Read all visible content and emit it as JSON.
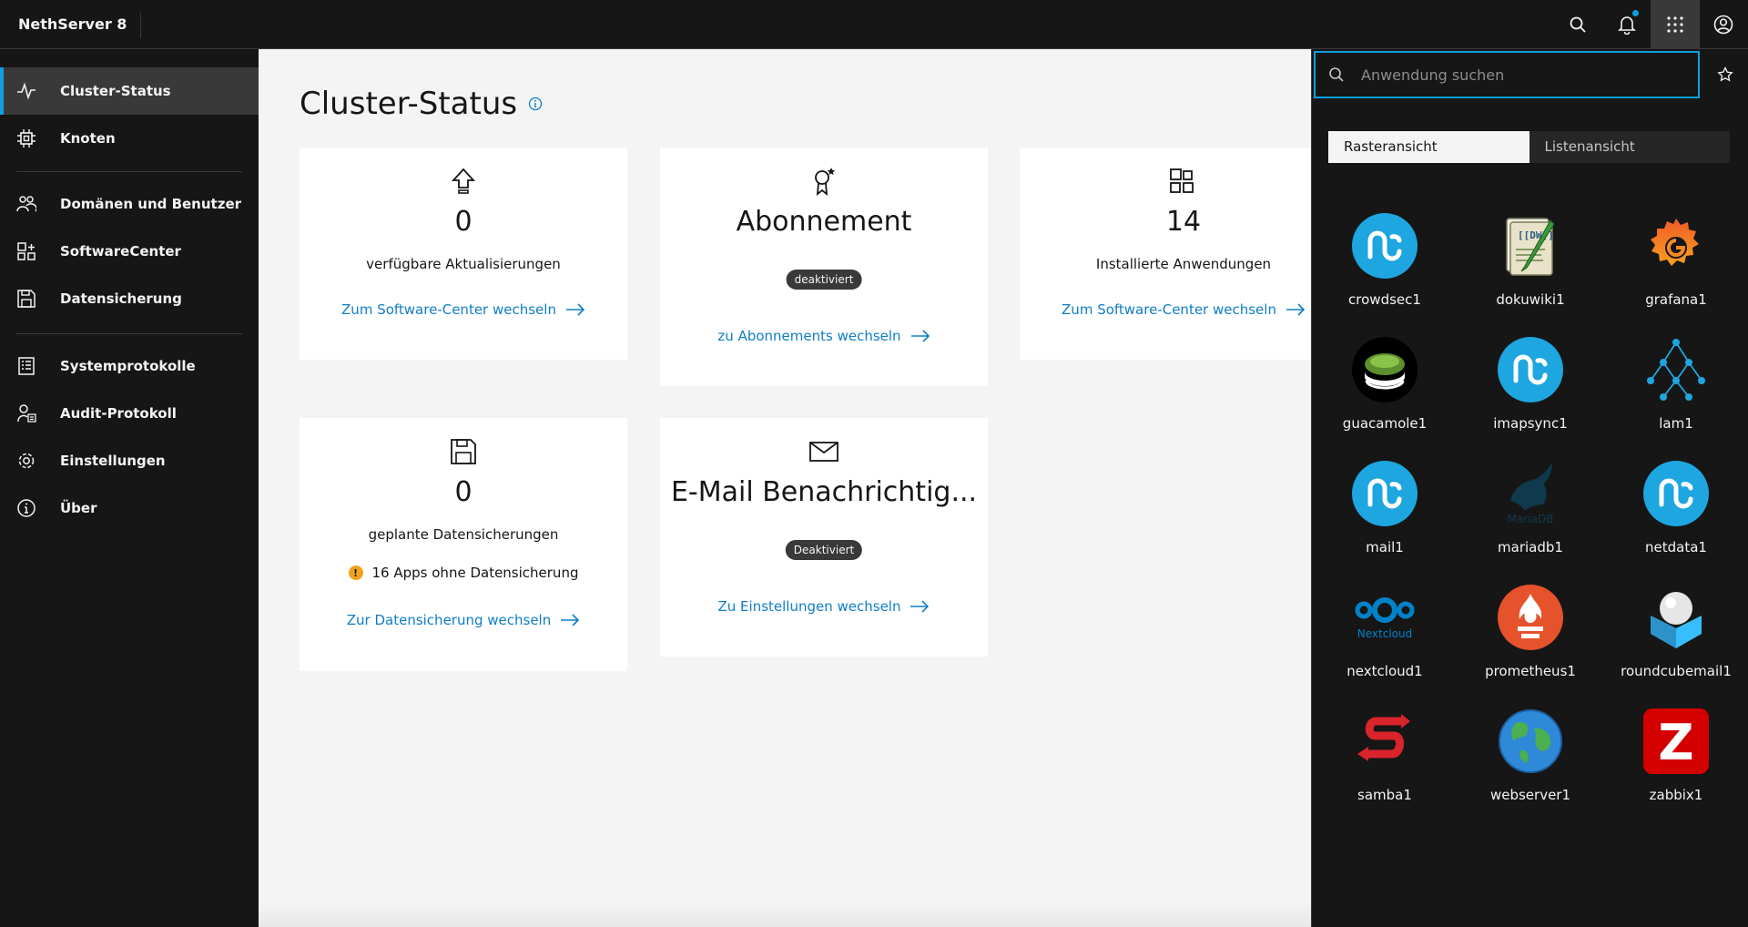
{
  "header": {
    "brand": "NethServer 8",
    "icons": [
      "search-icon",
      "notification-icon",
      "app-switcher-icon",
      "user-avatar-icon"
    ]
  },
  "sidebar": {
    "items": [
      {
        "label": "Cluster-Status",
        "icon": "activity-icon",
        "active": true
      },
      {
        "label": "Knoten",
        "icon": "chip-icon"
      },
      {
        "label": "Domänen und Benutzer",
        "icon": "users-icon"
      },
      {
        "label": "SoftwareCenter",
        "icon": "apps-icon"
      },
      {
        "label": "Datensicherung",
        "icon": "save-icon"
      },
      {
        "label": "Systemprotokolle",
        "icon": "logs-icon"
      },
      {
        "label": "Audit-Protokoll",
        "icon": "audit-icon"
      },
      {
        "label": "Einstellungen",
        "icon": "gear-icon"
      },
      {
        "label": "Über",
        "icon": "info-icon"
      }
    ]
  },
  "main": {
    "title": "Cluster-Status",
    "cards": {
      "updates": {
        "value": "0",
        "description": "verfügbare Aktualisierungen",
        "link": "Zum Software-Center wechseln"
      },
      "subscription": {
        "value": "Abonnement",
        "tag": "deaktiviert",
        "link": "zu Abonnements wechseln"
      },
      "installed": {
        "value": "14",
        "description": "Installierte Anwendungen",
        "link": "Zum Software-Center wechseln"
      },
      "backups": {
        "value": "0",
        "description": "geplante Datensicherungen",
        "warning": "16 Apps ohne Datensicherung",
        "link": "Zur Datensicherung wechseln"
      },
      "email": {
        "value": "E-Mail Benachrichtig...",
        "tag": "Deaktiviert",
        "link": "Zu Einstellungen wechseln"
      }
    }
  },
  "app_panel": {
    "search_placeholder": "Anwendung suchen",
    "views": [
      "Rasteransicht",
      "Listenansicht"
    ],
    "selected_view": "Rasteransicht",
    "apps": [
      {
        "name": "crowdsec1",
        "logo": "ns8-logo"
      },
      {
        "name": "dokuwiki1",
        "logo": "dokuwiki-logo"
      },
      {
        "name": "grafana1",
        "logo": "grafana-logo"
      },
      {
        "name": "guacamole1",
        "logo": "guacamole-logo"
      },
      {
        "name": "imapsync1",
        "logo": "ns8-logo"
      },
      {
        "name": "lam1",
        "logo": "lam-logo"
      },
      {
        "name": "mail1",
        "logo": "ns8-logo"
      },
      {
        "name": "mariadb1",
        "logo": "mariadb-logo",
        "logo_text": "MariaDB"
      },
      {
        "name": "netdata1",
        "logo": "ns8-logo"
      },
      {
        "name": "nextcloud1",
        "logo": "nextcloud-logo",
        "logo_text": "Nextcloud"
      },
      {
        "name": "prometheus1",
        "logo": "prometheus-logo"
      },
      {
        "name": "roundcubemail1",
        "logo": "roundcube-logo"
      },
      {
        "name": "samba1",
        "logo": "samba-logo"
      },
      {
        "name": "webserver1",
        "logo": "globe-logo"
      },
      {
        "name": "zabbix1",
        "logo": "zabbix-logo",
        "logo_text": "Z"
      }
    ]
  },
  "colors": {
    "accent": "#0f9fe0",
    "link": "#0f7ec6",
    "dark": "#161616",
    "warning": "#f1a21c"
  }
}
